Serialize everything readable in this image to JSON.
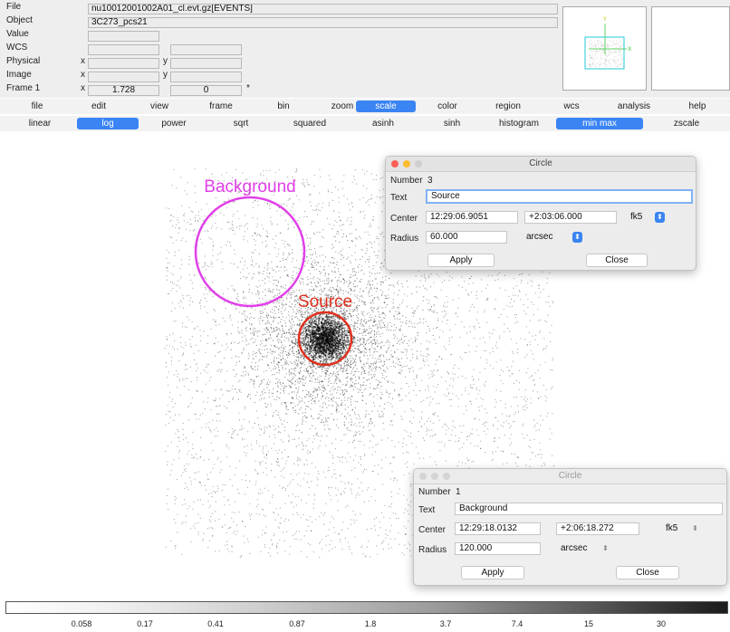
{
  "info_panel": {
    "labels": {
      "file": "File",
      "object": "Object",
      "value": "Value",
      "wcs": "WCS",
      "physical": "Physical",
      "image": "Image",
      "frame": "Frame 1"
    },
    "file_value": "nu10012001002A01_cl.evt.gz[EVENTS]",
    "object_value": "3C273_pcs21",
    "x_label": "x",
    "y_label": "y",
    "frame_x": "1.728",
    "frame_y": "0",
    "frame_mark": "*"
  },
  "main_menu": [
    "file",
    "edit",
    "view",
    "frame",
    "bin",
    "zoom",
    "scale",
    "color",
    "region",
    "wcs",
    "analysis",
    "help"
  ],
  "main_menu_active": "scale",
  "scale_menu": [
    "linear",
    "log",
    "power",
    "sqrt",
    "squared",
    "asinh",
    "sinh",
    "histogram",
    "min max",
    "zscale"
  ],
  "scale_active": [
    "log",
    "min max"
  ],
  "regions": {
    "background_label": "Background",
    "source_label": "Source",
    "background_color": "#e040e8",
    "source_color": "#e0301e"
  },
  "dialog_source": {
    "title": "Circle",
    "number_label": "Number",
    "number": "3",
    "text_label": "Text",
    "text": "Source",
    "center_label": "Center",
    "ra": "12:29:06.9051",
    "dec": "+2:03:06.000",
    "system": "fk5",
    "radius_label": "Radius",
    "radius": "60.000",
    "units": "arcsec",
    "apply": "Apply",
    "close": "Close"
  },
  "dialog_background": {
    "title": "Circle",
    "number_label": "Number",
    "number": "1",
    "text_label": "Text",
    "text": "Background",
    "center_label": "Center",
    "ra": "12:29:18.0132",
    "dec": "+2:06:18.272",
    "system": "fk5",
    "radius_label": "Radius",
    "radius": "120.000",
    "units": "arcsec",
    "apply": "Apply",
    "close": "Close"
  },
  "colorbar_ticks": [
    "0.058",
    "0.17",
    "0.41",
    "0.87",
    "1.8",
    "3.7",
    "7.4",
    "15",
    "30"
  ],
  "accent": "#3a84f3"
}
